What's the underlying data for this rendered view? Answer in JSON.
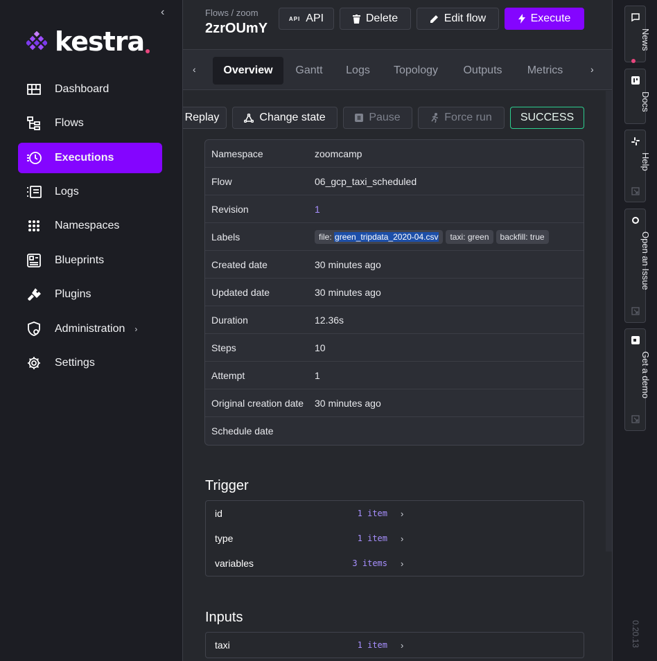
{
  "brand": {
    "name": "kestra"
  },
  "sidebar": {
    "collapse_icon": "chevron-left-icon",
    "items": [
      {
        "label": "Dashboard",
        "icon": "dashboard-icon",
        "active": false
      },
      {
        "label": "Flows",
        "icon": "flows-icon",
        "active": false
      },
      {
        "label": "Executions",
        "icon": "executions-icon",
        "active": true
      },
      {
        "label": "Logs",
        "icon": "logs-icon",
        "active": false
      },
      {
        "label": "Namespaces",
        "icon": "namespaces-icon",
        "active": false
      },
      {
        "label": "Blueprints",
        "icon": "blueprints-icon",
        "active": false
      },
      {
        "label": "Plugins",
        "icon": "plugins-icon",
        "active": false
      },
      {
        "label": "Administration",
        "icon": "administration-icon",
        "active": false
      },
      {
        "label": "Settings",
        "icon": "settings-icon",
        "active": false
      }
    ]
  },
  "header": {
    "breadcrumb": "Flows / zoom",
    "execution_id": "2zrOUmY",
    "buttons": {
      "api": "API",
      "delete": "Delete",
      "edit": "Edit flow",
      "execute": "Execute"
    }
  },
  "tabs": [
    "Overview",
    "Gantt",
    "Logs",
    "Topology",
    "Outputs",
    "Metrics"
  ],
  "actions": {
    "replay": "Replay",
    "change_state": "Change state",
    "pause": "Pause",
    "force_run": "Force run",
    "status": "SUCCESS"
  },
  "overview": {
    "namespace": {
      "label": "Namespace",
      "value": "zoomcamp"
    },
    "flow": {
      "label": "Flow",
      "value": "06_gcp_taxi_scheduled"
    },
    "revision": {
      "label": "Revision",
      "value": "1"
    },
    "labels": {
      "label": "Labels",
      "chips": [
        {
          "key": "file:",
          "value": "green_tripdata_2020-04.csv"
        },
        {
          "key": "taxi:",
          "value": "green"
        },
        {
          "key": "backfill:",
          "value": "true"
        }
      ]
    },
    "created": {
      "label": "Created date",
      "value": "30 minutes ago"
    },
    "updated": {
      "label": "Updated date",
      "value": "30 minutes ago"
    },
    "duration": {
      "label": "Duration",
      "value": "12.36s"
    },
    "steps": {
      "label": "Steps",
      "value": "10"
    },
    "attempt": {
      "label": "Attempt",
      "value": "1"
    },
    "original": {
      "label": "Original creation date",
      "value": "30 minutes ago"
    },
    "schedule": {
      "label": "Schedule date",
      "value": ""
    }
  },
  "trigger": {
    "title": "Trigger",
    "rows": [
      {
        "key": "id",
        "count": "1 item"
      },
      {
        "key": "type",
        "count": "1 item"
      },
      {
        "key": "variables",
        "count": "3 items"
      }
    ]
  },
  "inputs": {
    "title": "Inputs",
    "rows": [
      {
        "key": "taxi",
        "count": "1 item"
      }
    ]
  },
  "rail": {
    "news": "News",
    "docs": "Docs",
    "help": "Help",
    "issue": "Open an Issue",
    "demo": "Get a demo",
    "version": "0.20.13"
  },
  "colors": {
    "accent": "#8405ff",
    "success": "#2dcf8f",
    "link": "#a890ff",
    "brand_dot": "#e8457d"
  }
}
